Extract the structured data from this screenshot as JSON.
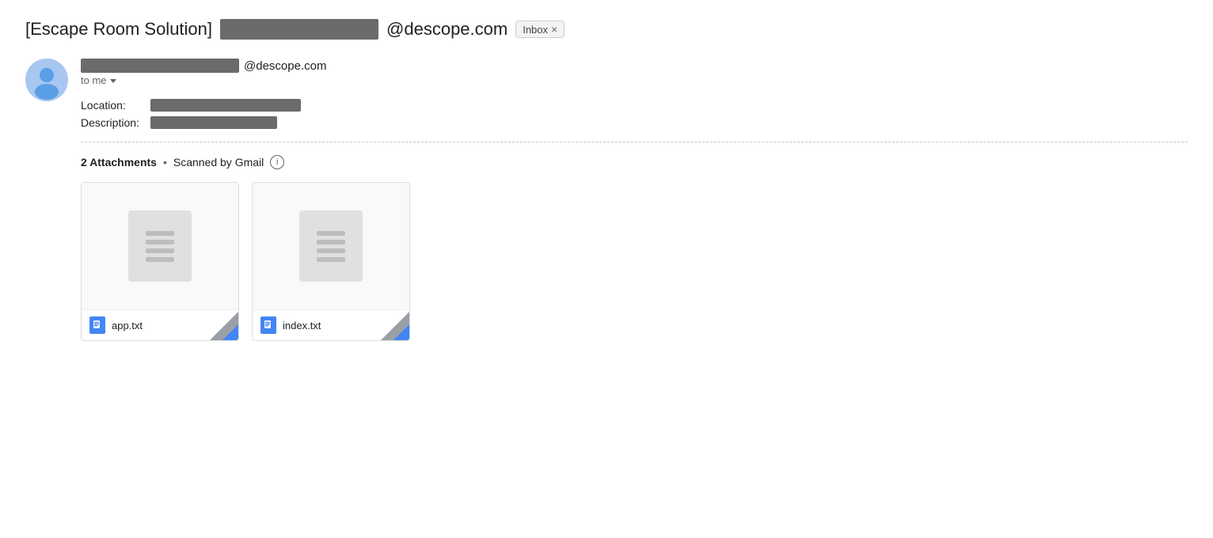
{
  "subject": {
    "prefix": "[Escape Room Solution]",
    "redacted_width": 200,
    "domain_suffix": "@descope.com",
    "inbox_label": "Inbox",
    "inbox_close": "×"
  },
  "sender": {
    "domain": "@descope.com",
    "redacted_width": 200
  },
  "to_me": {
    "label": "to me"
  },
  "fields": {
    "location_label": "Location:",
    "description_label": "Description:"
  },
  "attachments": {
    "count_label": "2 Attachments",
    "dot": "•",
    "scanned_label": "Scanned by Gmail",
    "info_icon": "i",
    "files": [
      {
        "name": "app.txt"
      },
      {
        "name": "index.txt"
      }
    ]
  }
}
